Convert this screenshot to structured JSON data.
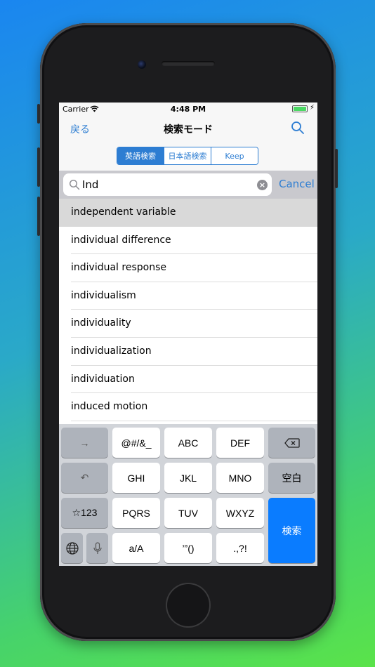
{
  "status": {
    "carrier": "Carrier",
    "time": "4:48 PM",
    "battery_level": 1.0
  },
  "nav": {
    "back_label": "戻る",
    "title": "検索モード",
    "search_icon": "search-icon"
  },
  "segments": [
    "英語検索",
    "日本語検索",
    "Keep"
  ],
  "segment_selected": 0,
  "search": {
    "value": "Ind",
    "cancel_label": "Cancel"
  },
  "results": [
    "independent variable",
    "individual difference",
    "individual response",
    "individualism",
    "individuality",
    "individualization",
    "individuation",
    "induced motion"
  ],
  "keyboard": {
    "rows": [
      [
        "→",
        "@#/&_",
        "ABC",
        "DEF",
        "⌫"
      ],
      [
        "↶",
        "GHI",
        "JKL",
        "MNO",
        "空白"
      ],
      [
        "☆123",
        "PQRS",
        "TUV",
        "WXYZ",
        "検索"
      ],
      [
        "globe-icon",
        "mic-icon",
        "a/A",
        "’”()",
        ".,?!"
      ]
    ]
  },
  "colors": {
    "accent": "#2d7dd2",
    "search_key": "#0a7cff",
    "battery": "#4cd964"
  }
}
